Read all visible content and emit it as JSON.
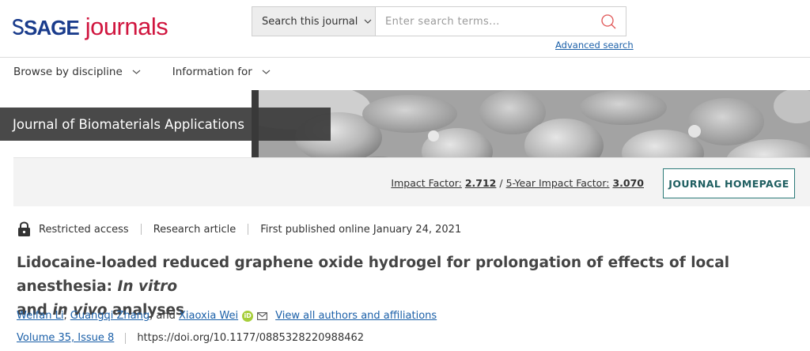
{
  "brand": {
    "sage": "SAGE",
    "journals": "journals",
    "sage_color": "#1a3c8c",
    "journals_color": "#d0163f"
  },
  "search": {
    "scope_label": "Search this journal",
    "placeholder": "Enter search terms...",
    "advanced_label": "Advanced search",
    "icon": "search-icon"
  },
  "nav": {
    "items": [
      {
        "label": "Browse by discipline"
      },
      {
        "label": "Information for"
      }
    ]
  },
  "banner": {
    "journal_title": "Journal of Biomaterials Applications"
  },
  "impact": {
    "impact_label": "Impact Factor:",
    "impact_value": "2.712",
    "separator": "/",
    "five_year_label": "5-Year Impact Factor:",
    "five_year_value": "3.070",
    "homepage_button": "JOURNAL HOMEPAGE",
    "button_color": "#2b7a78"
  },
  "article": {
    "access": "Restricted access",
    "type": "Research article",
    "published": "First published online January 24, 2021",
    "title_part1": "Lidocaine-loaded reduced graphene oxide hydrogel for prolongation of effects of local anesthesia: ",
    "title_italic1": "In vitro",
    "title_part2": "and ",
    "title_italic2": "in vivo",
    "title_part3": " analyses",
    "authors": [
      {
        "name": "Weifan Li"
      },
      {
        "name": "Guangqi Zhang"
      },
      {
        "name": "Xiaoxia Wei"
      }
    ],
    "author_sep_1": ", ",
    "author_sep_2": ", and ",
    "view_all": "View all authors and affiliations",
    "volume_issue": "Volume 35, Issue 8",
    "doi": "https://doi.org/10.1177/0885328220988462",
    "orcid_text": "iD",
    "link_color": "#1a5fa8"
  }
}
